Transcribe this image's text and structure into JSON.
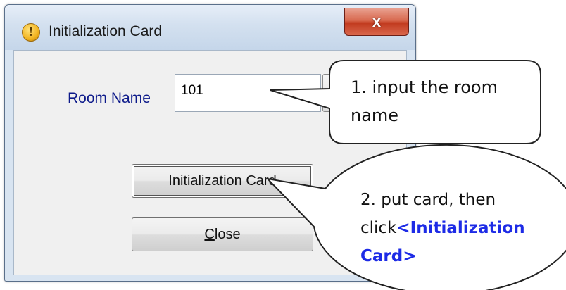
{
  "window": {
    "title": "Initialization Card",
    "close_glyph": "x"
  },
  "form": {
    "room_label": "Room Name",
    "room_value": "101",
    "init_button": "Initialization Card",
    "close_button_rest": "lose",
    "close_button_mnemonic": "C"
  },
  "callouts": [
    {
      "text": "1. input the room name"
    },
    {
      "text_prefix": "2. put card, then click",
      "text_highlight": "<Initialization Card>"
    }
  ],
  "colors": {
    "highlight": "#1d2be6",
    "label": "#0d1a8a"
  },
  "icons": {
    "title": "info-shield-icon",
    "close": "close-icon"
  }
}
